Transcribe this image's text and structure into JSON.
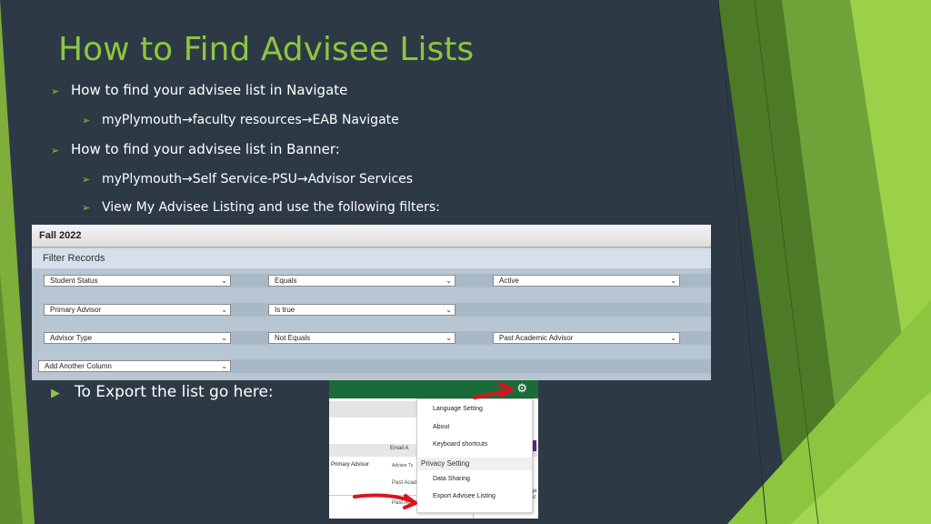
{
  "title": "How to Find Advisee Lists",
  "bullets": {
    "navigate": "How to find your advisee list in Navigate",
    "navigate_path": "myPlymouth→faculty resources→EAB Navigate",
    "banner": "How to find your advisee list in Banner:",
    "banner_path": "myPlymouth→Self Service-PSU→Advisor Services",
    "banner_view": "View My Advisee Listing and use the following filters:",
    "export": "To Export the list go here:"
  },
  "banner_screenshot": {
    "term": "Fall 2022",
    "filter_header": "Filter Records",
    "rows": [
      {
        "column": "Student Status",
        "operator": "Equals",
        "value": "Active"
      },
      {
        "column": "Primary Advisor",
        "operator": "Is true",
        "value": ""
      },
      {
        "column": "Advisor Type",
        "operator": "Not Equals",
        "value": "Past Academic Advisor"
      },
      {
        "column": "Add Another Column",
        "operator": "",
        "value": ""
      }
    ]
  },
  "menu_screenshot": {
    "items": {
      "language": "Language Setting",
      "about": "About",
      "shortcuts": "Keyboard shortcuts",
      "privacy_header": "Privacy Setting",
      "data_sharing": "Data Sharing",
      "export": "Export Advisee Listing"
    },
    "background": {
      "email": "Email A",
      "primary_advisor": "Primary Advisor",
      "advisor_type": "Advisor Ty",
      "past_acad_1": "Past Acad",
      "past_acad_2": "Past Acad",
      "cut_text": "ge\nat"
    }
  },
  "colors": {
    "background": "#2d3a46",
    "accent_green": "#8cc63f",
    "annotation_red": "#d8141c"
  },
  "icons": {
    "bullet_primary": "arrow-bullet-icon",
    "bullet_export": "triangle-bullet-icon",
    "settings": "gear-icon",
    "dropdown": "chevron-down-icon"
  }
}
